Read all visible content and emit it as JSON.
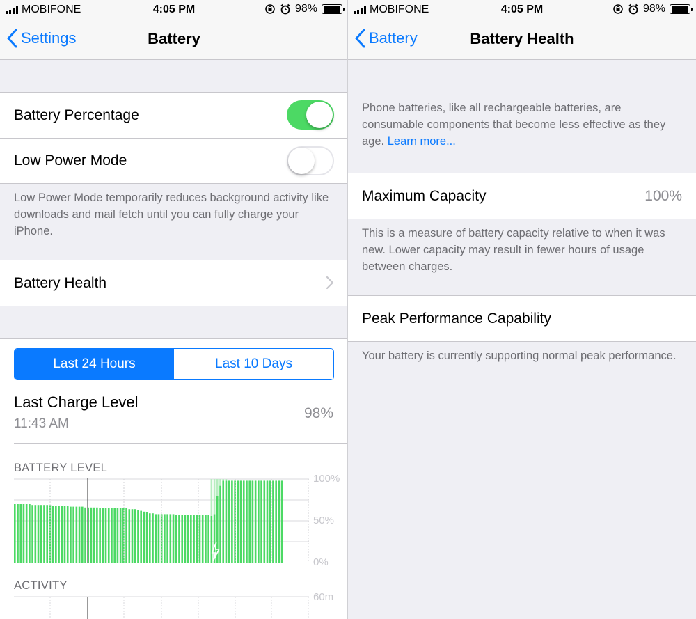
{
  "status_bar": {
    "carrier": "MOBIFONE",
    "time": "4:05 PM",
    "battery_percent": "98%",
    "battery_level": 0.98
  },
  "left": {
    "nav": {
      "back_label": "Settings",
      "title": "Battery"
    },
    "toggles": {
      "battery_percentage": {
        "label": "Battery Percentage",
        "on": true
      },
      "low_power_mode": {
        "label": "Low Power Mode",
        "on": false
      }
    },
    "low_power_footnote": "Low Power Mode temporarily reduces background activity like downloads and mail fetch until you can fully charge your iPhone.",
    "battery_health_label": "Battery Health",
    "segments": {
      "last_24": "Last 24 Hours",
      "last_10": "Last 10 Days",
      "selected": "last_24"
    },
    "last_charge": {
      "title": "Last Charge Level",
      "time": "11:43 AM",
      "value": "98%"
    },
    "battery_level_label": "BATTERY LEVEL",
    "activity_label": "ACTIVITY",
    "axis": {
      "p100": "100%",
      "p50": "50%",
      "p0": "0%",
      "m60": "60m"
    }
  },
  "right": {
    "nav": {
      "back_label": "Battery",
      "title": "Battery Health"
    },
    "intro": "Phone batteries, like all rechargeable batteries, are consumable components that become less effective as they age.",
    "learn_more": "Learn more...",
    "max_capacity": {
      "label": "Maximum Capacity",
      "value": "100%"
    },
    "capacity_footnote": "This is a measure of battery capacity relative to when it was new. Lower capacity may result in fewer hours of usage between charges.",
    "peak_label": "Peak Performance Capability",
    "peak_footnote": "Your battery is currently supporting normal peak performance."
  },
  "colors": {
    "accent": "#0a7aff",
    "toggle_on": "#4cd964",
    "chart_green": "#4cd964",
    "chart_light_green": "#b7edc0"
  },
  "chart_data": {
    "type": "bar",
    "title": "BATTERY LEVEL",
    "ylim": [
      0,
      100
    ],
    "y_ticks": [
      "0%",
      "50%",
      "100%"
    ],
    "values": [
      70,
      70,
      70,
      70,
      70,
      70,
      69,
      69,
      69,
      69,
      69,
      69,
      69,
      68,
      68,
      68,
      68,
      68,
      68,
      67,
      67,
      67,
      67,
      67,
      66,
      66,
      66,
      66,
      66,
      65,
      65,
      65,
      65,
      65,
      65,
      65,
      65,
      65,
      65,
      64,
      64,
      64,
      63,
      62,
      61,
      60,
      59,
      59,
      58,
      58,
      58,
      58,
      58,
      58,
      58,
      57,
      57,
      57,
      57,
      57,
      57,
      57,
      57,
      57,
      57,
      57,
      57,
      56,
      58,
      80,
      92,
      98,
      98,
      98,
      98,
      98,
      98,
      98,
      98,
      98,
      98,
      98,
      98,
      98,
      98,
      98,
      98,
      98,
      98,
      98,
      98,
      98
    ],
    "charging_range": [
      67,
      73
    ]
  }
}
